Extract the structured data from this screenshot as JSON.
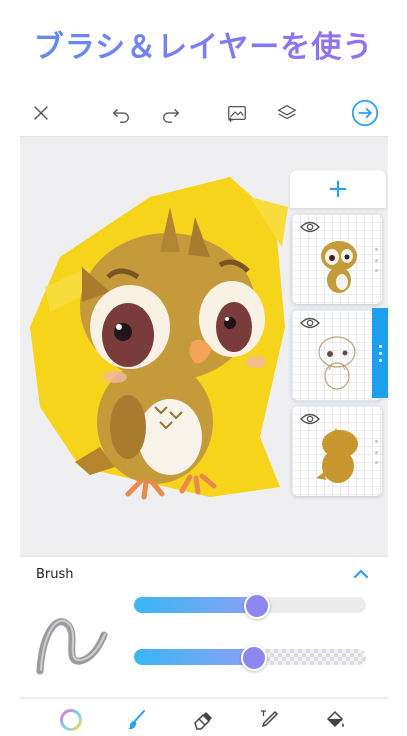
{
  "headline": "ブラシ＆レイヤーを使う",
  "toolbar": {
    "icons": [
      "close-icon",
      "undo-icon",
      "redo-icon",
      "image-add-icon",
      "layers-icon",
      "next-arrow-icon"
    ],
    "accent": "#2aa0f0"
  },
  "layers": {
    "add_label": "+",
    "items": [
      {
        "name": "layer-1",
        "visible": true
      },
      {
        "name": "layer-2",
        "visible": true,
        "active": true
      },
      {
        "name": "layer-3",
        "visible": true
      }
    ]
  },
  "brush_panel": {
    "title": "Brush",
    "size_value": 0.52,
    "opacity_value": 0.51
  },
  "bottom_tools": [
    "color-wheel-icon",
    "brush-icon",
    "eraser-icon",
    "text-pen-icon",
    "fill-bucket-icon"
  ],
  "colors": {
    "canvas_yellow": "#f5d20f",
    "owl_body": "#c59a3b",
    "active_layer": "#1ea0f0",
    "slider_thumb": "#8f86ee"
  }
}
